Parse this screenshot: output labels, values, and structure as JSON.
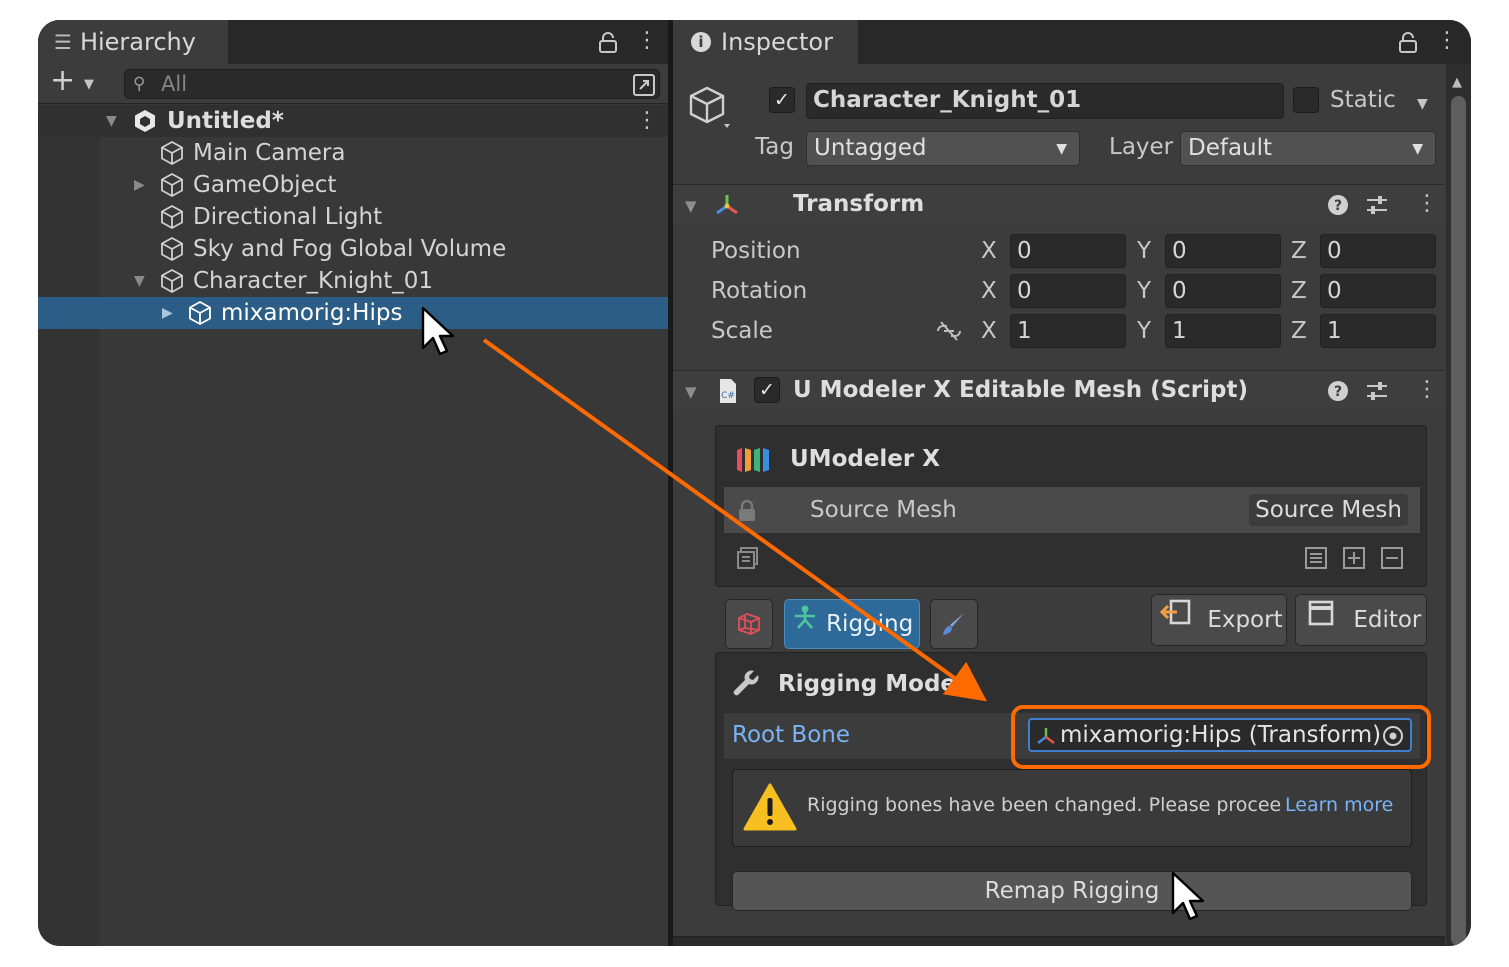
{
  "hierarchy": {
    "tab_title": "Hierarchy",
    "search_placeholder": "All",
    "items": [
      {
        "label": "Untitled*"
      },
      {
        "label": "Main Camera"
      },
      {
        "label": "GameObject"
      },
      {
        "label": "Directional Light"
      },
      {
        "label": "Sky and Fog Global Volume"
      },
      {
        "label": "Character_Knight_01"
      },
      {
        "label": "mixamorig:Hips"
      }
    ]
  },
  "inspector": {
    "tab_title": "Inspector",
    "object_name": "Character_Knight_01",
    "static_label": "Static",
    "tag_label": "Tag",
    "tag_value": "Untagged",
    "layer_label": "Layer",
    "layer_value": "Default",
    "transform": {
      "title": "Transform",
      "rows": [
        {
          "label": "Position",
          "x": "0",
          "y": "0",
          "z": "0"
        },
        {
          "label": "Rotation",
          "x": "0",
          "y": "0",
          "z": "0"
        },
        {
          "label": "Scale",
          "x": "1",
          "y": "1",
          "z": "1"
        }
      ],
      "axis_x": "X",
      "axis_y": "Y",
      "axis_z": "Z"
    },
    "script": {
      "title": "U Modeler X Editable Mesh (Script)",
      "brand": "UModeler X",
      "source_mesh_label": "Source Mesh",
      "source_mesh_value": "Source Mesh",
      "tab_rigging": "Rigging",
      "export_label": "Export",
      "editor_label": "Editor",
      "mode_title": "Rigging Mode",
      "root_bone_label": "Root Bone",
      "root_bone_value": "mixamorig:Hips (Transform)",
      "warning_text": "Rigging bones have been changed. Please procee",
      "learn_more": "Learn more",
      "remap_button": "Remap Rigging"
    }
  },
  "colors": {
    "selection": "#2c5d87",
    "annotation": "#ff6a00",
    "link": "#7ab4f5",
    "warning": "#f7c020"
  }
}
